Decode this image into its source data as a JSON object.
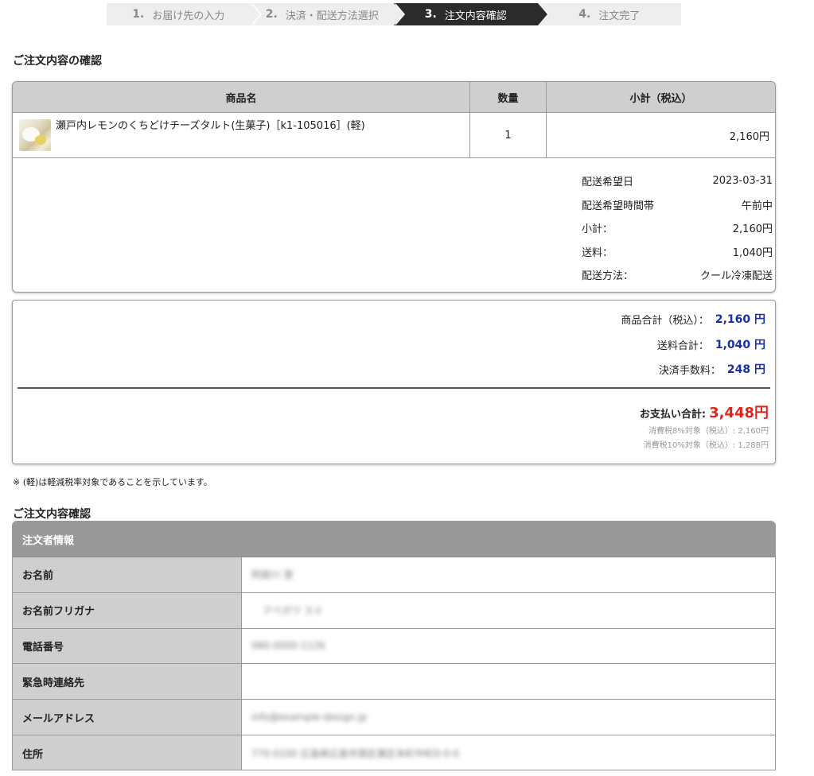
{
  "steps": [
    {
      "num": "1.",
      "label": "お届け先の入力",
      "active": false
    },
    {
      "num": "2.",
      "label": "決済・配送方法選択",
      "active": false
    },
    {
      "num": "3.",
      "label": "注文内容確認",
      "active": true
    },
    {
      "num": "4.",
      "label": "注文完了",
      "active": false
    }
  ],
  "order_section_title": "ご注文内容の確認",
  "order_table": {
    "headers": {
      "name": "商品名",
      "qty": "数量",
      "subtotal": "小計（税込）"
    },
    "items": [
      {
        "name": "瀬戸内レモンのくちどけチーズタルト(生菓子)［k1-105016］(軽)",
        "qty": "1",
        "subtotal": "2,160円"
      }
    ]
  },
  "shipping_info": [
    {
      "label": "配送希望日",
      "value": "2023-03-31"
    },
    {
      "label": "配送希望時間帯",
      "value": "午前中"
    },
    {
      "label": "小計：",
      "value": "2,160円"
    },
    {
      "label": "送料：",
      "value": "1,040円"
    },
    {
      "label": "配送方法：",
      "value": "クール冷凍配送"
    }
  ],
  "totals": {
    "product_total_label": "商品合計（税込）：",
    "product_total_value": "2,160 円",
    "shipping_total_label": "送料合計：",
    "shipping_total_value": "1,040 円",
    "fee_label": "決済手数料：",
    "fee_value": "248 円",
    "pay_total_label": "お支払い合計:",
    "pay_total_value": "3,448円",
    "tax8": "消費税8%対象（税込）: 2,160円",
    "tax10": "消費税10%対象（税込）: 1,288円"
  },
  "note": "※ (軽)は軽減税率対象であることを示しています。",
  "confirm_section_title": "ご注文内容確認",
  "customer": {
    "header": "注文者情報",
    "rows": [
      {
        "label": "お名前",
        "value": "阿部川 澄"
      },
      {
        "label": "お名前フリガナ",
        "value": "アベガワ スミ"
      },
      {
        "label": "電話番号",
        "value": "080-0000-1126"
      },
      {
        "label": "緊急時連絡先",
        "value": ""
      },
      {
        "label": "メールアドレス",
        "value": "info@example-design.jp"
      },
      {
        "label": "住所",
        "value": "770-0100 広島県広島市南区東区本町中町0-0-0"
      }
    ]
  },
  "colors": {
    "accent_blue": "#1a2fa0",
    "total_red": "#e2231a",
    "step_active": "#2b2b2b"
  }
}
